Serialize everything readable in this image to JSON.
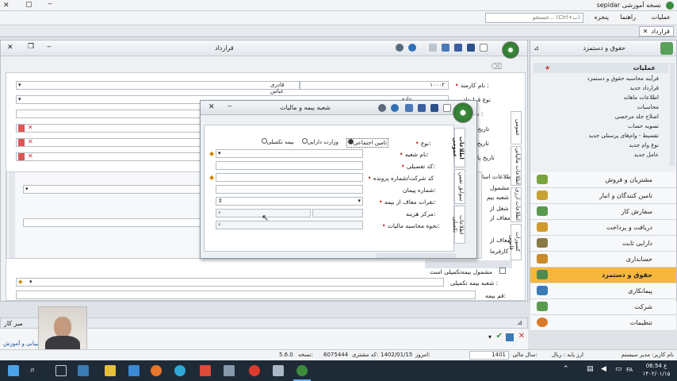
{
  "app": {
    "title": "sepidar نسخه آموزشی",
    "search_placeholder": "جستجو... (Ctrl+ب)"
  },
  "menu": {
    "items": [
      "عملیات",
      "راهنما",
      "پنجره"
    ]
  },
  "tab": {
    "label": "قرارداد"
  },
  "main": {
    "title": "قرارداد",
    "labels": {
      "employee_name": "نام کارمند :",
      "contract_type": "نوع قرارداد",
      "number": "شماره :",
      "date1": "تاریخ صدو",
      "date2": "تاریخ اعتبا",
      "date3": "تاریخ پایان ق",
      "insurance_info": "اطلاعات اسا",
      "insured": "مشمول",
      "branch": "شعبه بیم",
      "job": "شغل از",
      "exempt": "معاف از",
      "exempt2": "معاف از",
      "worker": "کارفرما",
      "supp_insured": "مشمول بیمه‌تکمیلی است",
      "supp_branch": "شعبه بیمه تکمیلی :",
      "ins_no": "قم بیمه:"
    },
    "values": {
      "employee_code": "۱۰۰۰۲",
      "employee_name": "قادری عباس",
      "contract_type": "عادی"
    },
    "vertical_tabs": [
      "عمومی",
      "اطلاعات مالیاتی",
      "اطلاعات ارزی",
      "کسورات قانونی"
    ]
  },
  "dialog": {
    "title": "شعبه بیمه و مالیات",
    "radios": [
      "تامین اجتماعی",
      "وزارت دارایی",
      "بیمه تکمیلی"
    ],
    "labels": {
      "type": "نوع:",
      "branch_name": "نام شعبه:",
      "detail_code": "کد تفصیلی:",
      "workshop_code": "کد شرکت/شماره پرونده",
      "branch_no": "شماره پیمان:",
      "exempt_ins": "نقرات معاف از بیمه:",
      "cost_center": "مرکز هزینه:",
      "tax_method": "نحوه محاسبه مالیات:"
    },
    "vertical_tabs": [
      "اطلاعات عمومی",
      "سوابق تعیین",
      "اطلاعات تکمیلی"
    ]
  },
  "nav": {
    "header": "حقوق و دستمزد",
    "section": "عملیات",
    "items": [
      "فرآیند محاسبه حقوق و دستمزد",
      "قرارداد جدید",
      "اطلاعات ماهانه",
      "محاسبات",
      "اصلاح جلد مرخصی",
      "تسویه حساب",
      "تقسیط - وام‌های پرسنلی جدید",
      "نوع وام جدید",
      "عامل جدید"
    ],
    "modules": [
      "مشتریان و فروش",
      "تامین کنندگان و انبار",
      "سفارش کار",
      "دریافت و پرداخت",
      "دارایی ثابت",
      "حسابداری",
      "حقوق و دستمزد",
      "پیمانکاری",
      "شرکت",
      "تنظیمات"
    ]
  },
  "desk": {
    "label": "میز کار",
    "bottom_label": "پشتیبانی و آموزش"
  },
  "status": {
    "fiscal_year": "1401",
    "fiscal_label": "سال مالی:",
    "currency": "ارز پایه : ریال",
    "today": "1402/01/15",
    "today_label": "امروز:",
    "customer_code": "6075444",
    "customer_label": "کد مشتری:",
    "version": "5.6.0",
    "version_label": "نسخه:",
    "user": "نام کاربر: مدیر سیستم"
  },
  "clock": {
    "time": "06:54 ع",
    "date": "۱۴۰۲/۰۱/۱۵",
    "day": "عصر"
  }
}
